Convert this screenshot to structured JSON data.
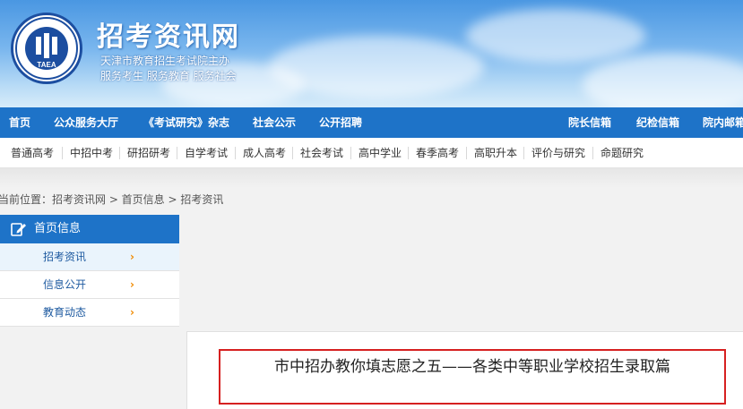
{
  "site": {
    "title": "招考资讯网",
    "subtitle1": "天津市教育招生考试院主办",
    "subtitle2": "服务考生 服务教育 服务社会",
    "logo_text": "TAEA"
  },
  "main_nav": {
    "items": [
      "首页",
      "公众服务大厅",
      "《考试研究》杂志",
      "社会公示",
      "公开招聘"
    ],
    "right_items": [
      "院长信箱",
      "纪检信箱",
      "院内邮箱"
    ]
  },
  "sub_nav": {
    "items": [
      "普通高考",
      "中招中考",
      "研招研考",
      "自学考试",
      "成人高考",
      "社会考试",
      "高中学业",
      "春季高考",
      "高职升本",
      "评价与研究",
      "命题研究"
    ]
  },
  "breadcrumb": {
    "text": "当前位置：招考资讯网 > 首页信息 > 招考资讯"
  },
  "sidebar": {
    "heading": "首页信息",
    "items": [
      {
        "label": "招考资讯",
        "arrow": "›"
      },
      {
        "label": "信息公开",
        "arrow": "›"
      },
      {
        "label": "教育动态",
        "arrow": "›"
      }
    ]
  },
  "article": {
    "title": "市中招办教你填志愿之五——各类中等职业学校招生录取篇"
  },
  "colors": {
    "nav_blue": "#1e73c8",
    "highlight_red": "#d62020",
    "arrow_orange": "#f08a00"
  },
  "icons": [
    "logo-emblem-icon",
    "edit-icon",
    "chevron-right-icon"
  ]
}
